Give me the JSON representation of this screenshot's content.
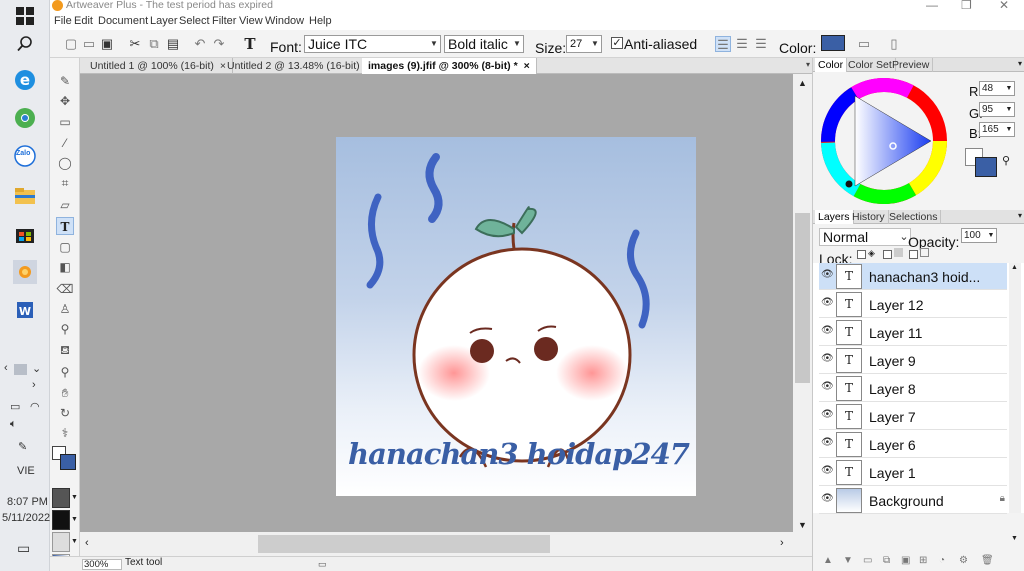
{
  "window": {
    "title": "Artweaver Plus - The test period has expired",
    "controls": {
      "minimize": "—",
      "maximize": "❐",
      "close": "✕"
    }
  },
  "menu": [
    "File",
    "Edit",
    "Document",
    "Layer",
    "Select",
    "Filter",
    "View",
    "Window",
    "Help"
  ],
  "toolbar": {
    "font_label": "Font:",
    "font_value": "Juice ITC",
    "style_value": "Bold italic",
    "size_label": "Size:",
    "size_value": "27",
    "antialias_label": "Anti-aliased",
    "antialias_checked": true,
    "color_label": "Color:",
    "color_value": "#3a5fa5"
  },
  "tabs": [
    {
      "label": "Untitled 1 @ 100% (16-bit)",
      "close": "×",
      "active": false
    },
    {
      "label": "Untitled 2 @ 13.48% (16-bit) *",
      "close": "×",
      "active": false
    },
    {
      "label": "images (9).jfif @ 300% (8-bit) *",
      "close": "×",
      "active": true
    }
  ],
  "canvas": {
    "text": "hanachan3 hoidap247"
  },
  "status": {
    "zoom": "300%",
    "tool": "Text tool"
  },
  "color_panel": {
    "tabs": [
      "Color",
      "Color Set",
      "Preview"
    ],
    "r_label": "R:",
    "g_label": "G:",
    "b_label": "B:",
    "r": "48",
    "g": "95",
    "b": "165"
  },
  "layers_panel": {
    "tabs": [
      "Layers",
      "History",
      "Selections"
    ],
    "blend_mode": "Normal",
    "opacity_label": "Opacity:",
    "opacity_value": "100",
    "lock_label": "Lock:",
    "layers": [
      {
        "name": "hanachan3 hoid...",
        "type": "text",
        "selected": true,
        "thumb": "T"
      },
      {
        "name": "Layer 12",
        "type": "text",
        "selected": false,
        "thumb": "T"
      },
      {
        "name": "Layer 11",
        "type": "text",
        "selected": false,
        "thumb": "T"
      },
      {
        "name": "Layer 9",
        "type": "text",
        "selected": false,
        "thumb": "T"
      },
      {
        "name": "Layer 8",
        "type": "text",
        "selected": false,
        "thumb": "T"
      },
      {
        "name": "Layer 7",
        "type": "text",
        "selected": false,
        "thumb": "T"
      },
      {
        "name": "Layer 6",
        "type": "text",
        "selected": false,
        "thumb": "T"
      },
      {
        "name": "Layer 1",
        "type": "text",
        "selected": false,
        "thumb": "T"
      },
      {
        "name": "Background",
        "type": "image",
        "selected": false,
        "thumb": ""
      }
    ]
  },
  "taskbar": {
    "time": "8:07 PM",
    "date": "5/11/2022",
    "lang": "VIE",
    "zalo_label": "Zalo"
  }
}
